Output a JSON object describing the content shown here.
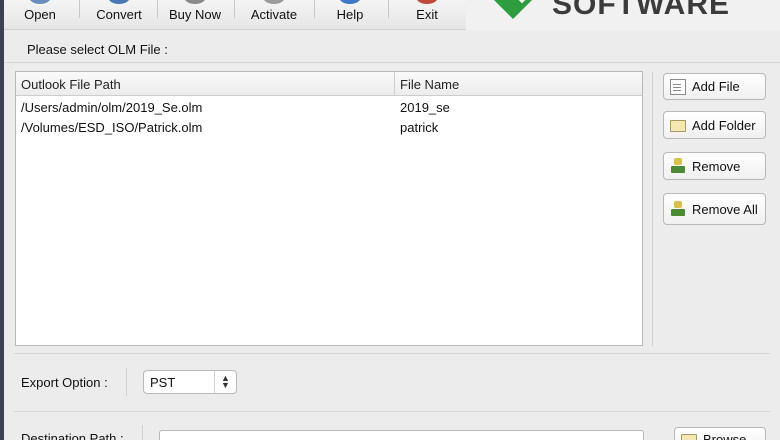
{
  "toolbar": {
    "open_label": "Open",
    "convert_label": "Convert",
    "buy_now_label": "Buy Now",
    "activate_label": "Activate",
    "help_label": "Help",
    "exit_label": "Exit"
  },
  "brand": {
    "logo_text": "SOFTWARE",
    "accent_color": "#2e9d3f"
  },
  "olm": {
    "prompt": "Please select OLM File :",
    "columns": {
      "path": "Outlook File Path",
      "name": "File Name"
    },
    "rows": [
      {
        "path": "/Users/admin/olm/2019_Se.olm",
        "name": "2019_se"
      },
      {
        "path": "/Volumes/ESD_ISO/Patrick.olm",
        "name": "patrick"
      }
    ]
  },
  "side_buttons": {
    "add_file": "Add File",
    "add_folder": "Add Folder",
    "remove": "Remove",
    "remove_all": "Remove All"
  },
  "export": {
    "label": "Export Option :",
    "selected": "PST"
  },
  "destination": {
    "label": "Destination Path :",
    "browse_label": "Browse"
  }
}
